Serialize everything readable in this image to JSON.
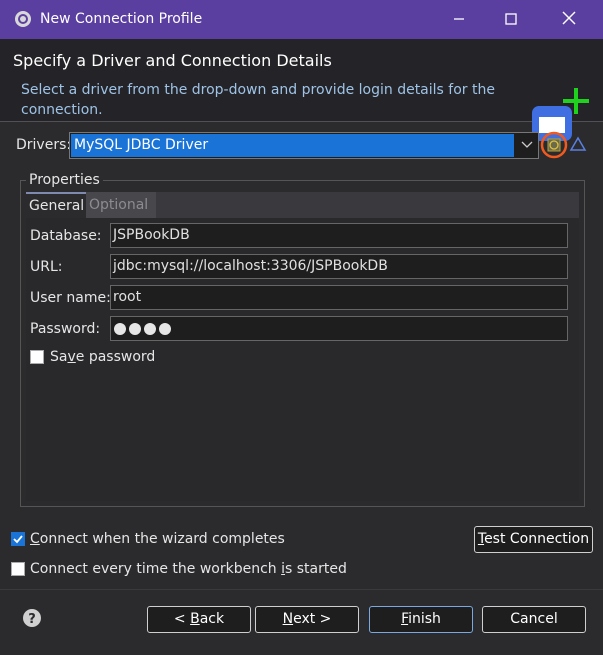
{
  "window": {
    "title": "New Connection Profile"
  },
  "header": {
    "title": "Specify a Driver and Connection Details",
    "description": "Select a driver from the drop-down and provide login details for the connection."
  },
  "drivers": {
    "label": "Drivers:",
    "selected": "MySQL JDBC Driver"
  },
  "properties": {
    "legend": "Properties",
    "tabs": [
      {
        "label": "General",
        "active": true
      },
      {
        "label": "Optional",
        "active": false
      }
    ],
    "fields": {
      "database": {
        "label": "Database:",
        "value": "JSPBookDB"
      },
      "url": {
        "label": "URL:",
        "value": "jdbc:mysql://localhost:3306/JSPBookDB"
      },
      "username": {
        "label": "User name:",
        "value": "root"
      },
      "password": {
        "label": "Password:",
        "masked_length": 4
      }
    },
    "save_password": {
      "label_pre": "Sa",
      "label_accel": "v",
      "label_post": "e password",
      "checked": false
    }
  },
  "options": {
    "connect_on_finish": {
      "label_accel": "C",
      "label_post": "onnect when the wizard completes",
      "checked": true
    },
    "connect_every_time": {
      "label_pre": "Connect every time the workbench ",
      "label_accel": "i",
      "label_post": "s started",
      "checked": false
    },
    "test_connection": {
      "label_accel": "T",
      "label_post": "est Connection"
    }
  },
  "footer": {
    "back": {
      "label_pre": "< ",
      "label_accel": "B",
      "label_post": "ack"
    },
    "next": {
      "label_accel": "N",
      "label_post": "ext >"
    },
    "finish": {
      "label_accel": "F",
      "label_post": "inish"
    },
    "cancel": {
      "label": "Cancel"
    }
  },
  "icons": {
    "app": "gear-icon",
    "new_driver": "new-driver-icon",
    "edit_driver": "triangle-edit-icon",
    "help": "help-icon",
    "wizard_banner": "database-plus-icon"
  },
  "colors": {
    "titlebar": "#5a3fa0",
    "selection": "#1a73d6",
    "highlight_circle": "#f05a1e",
    "plus_icon": "#1ed21e",
    "desc_text": "#9ec3e6"
  }
}
